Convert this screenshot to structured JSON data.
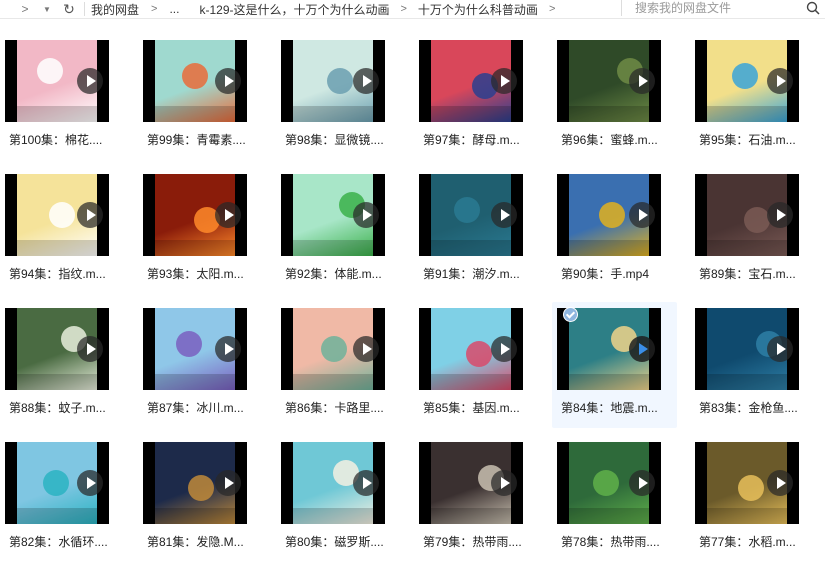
{
  "toolbar": {
    "back_icon": "chevron-left-icon",
    "forward_glyph": ">",
    "dropdown_glyph": "▼",
    "refresh_glyph": "↻"
  },
  "breadcrumb": {
    "items": [
      "我的网盘",
      "...",
      "k-129-这是什么，十万个为什么动画",
      "十万个为什么科普动画"
    ],
    "separator": ">"
  },
  "search": {
    "placeholder": "搜索我的网盘文件",
    "icon": "search-icon"
  },
  "files": [
    {
      "name": "第100集：棉花....",
      "bg": "#f2b8c6",
      "accent": "#ffffff",
      "selected": false
    },
    {
      "name": "第99集：青霉素....",
      "bg": "#9fd9cf",
      "accent": "#e96b3a",
      "selected": false
    },
    {
      "name": "第98集：显微镜....",
      "bg": "#cfe8e2",
      "accent": "#6b9fb0",
      "selected": false
    },
    {
      "name": "第97集：酵母.m...",
      "bg": "#d9475a",
      "accent": "#2a3f8f",
      "selected": false
    },
    {
      "name": "第96集：蜜蜂.m...",
      "bg": "#2f4a28",
      "accent": "#6e8b45",
      "selected": false
    },
    {
      "name": "第95集：石油.m...",
      "bg": "#f2df8a",
      "accent": "#3aa5d8",
      "selected": false
    },
    {
      "name": "第94集：指纹.m...",
      "bg": "#f5e39a",
      "accent": "#ffffff",
      "selected": false
    },
    {
      "name": "第93集：太阳.m...",
      "bg": "#8a1c0a",
      "accent": "#ff8a2a",
      "selected": false
    },
    {
      "name": "第92集：体能.m...",
      "bg": "#a8e6c8",
      "accent": "#3bb04a",
      "selected": false
    },
    {
      "name": "第91集：潮汐.m...",
      "bg": "#1f5f70",
      "accent": "#2a7a92",
      "selected": false
    },
    {
      "name": "第90集：手.mp4",
      "bg": "#3a6fb0",
      "accent": "#e2b21f",
      "selected": false
    },
    {
      "name": "第89集：宝石.m...",
      "bg": "#4a3433",
      "accent": "#7a5a55",
      "selected": false
    },
    {
      "name": "第88集：蚊子.m...",
      "bg": "#4a6b42",
      "accent": "#e8eedc",
      "selected": false
    },
    {
      "name": "第87集：冰川.m...",
      "bg": "#8fc7e8",
      "accent": "#7a5fc0",
      "selected": false
    },
    {
      "name": "第86集：卡路里....",
      "bg": "#f0b9a6",
      "accent": "#6fb29a",
      "selected": false
    },
    {
      "name": "第85集：基因.m...",
      "bg": "#7fd0e6",
      "accent": "#d94a6a",
      "selected": false
    },
    {
      "name": "第84集：地震.m...",
      "bg": "#2d7f86",
      "accent": "#f0d48a",
      "selected": true
    },
    {
      "name": "第83集：金枪鱼....",
      "bg": "#0f4a6e",
      "accent": "#2e7fa6",
      "selected": false
    },
    {
      "name": "第82集：水循环....",
      "bg": "#7fc6e2",
      "accent": "#2ab3c2",
      "selected": false
    },
    {
      "name": "第81集：发隐.M...",
      "bg": "#1d2a4a",
      "accent": "#c08a3a",
      "selected": false
    },
    {
      "name": "第80集：磁罗斯....",
      "bg": "#6fc8d6",
      "accent": "#f4f0e2",
      "selected": false
    },
    {
      "name": "第79集：热带雨....",
      "bg": "#3a3030",
      "accent": "#c9c0b0",
      "selected": false
    },
    {
      "name": "第78集：热带雨....",
      "bg": "#2e6a3a",
      "accent": "#5fb04a",
      "selected": false
    },
    {
      "name": "第77集：水稻.m...",
      "bg": "#6b5a2a",
      "accent": "#e8c05a",
      "selected": false
    }
  ]
}
